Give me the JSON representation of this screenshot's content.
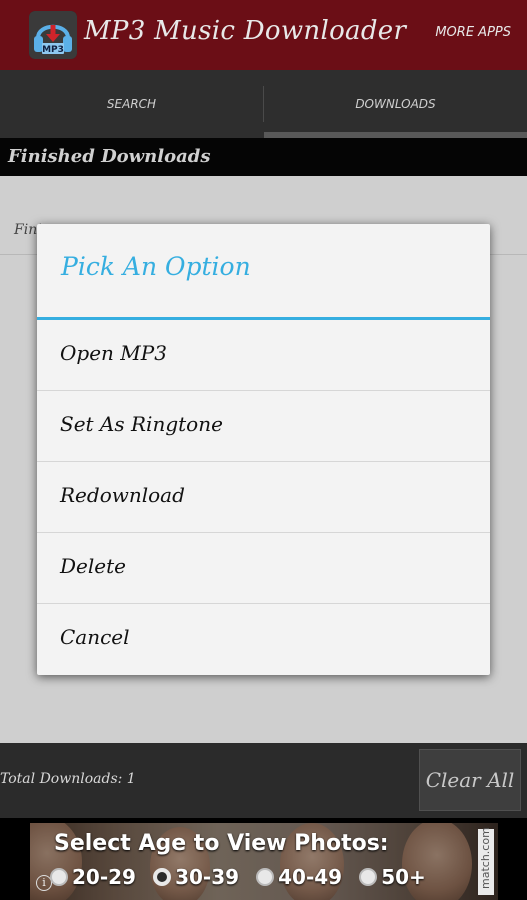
{
  "app": {
    "title": "MP3 Music Downloader",
    "icon": "mp3-headphones-icon",
    "icon_label": "MP3",
    "more_apps_label": "MORE APPS"
  },
  "tabs": [
    {
      "label": "SEARCH",
      "selected": false
    },
    {
      "label": "DOWNLOADS",
      "selected": true
    }
  ],
  "section": {
    "title": "Finished Downloads"
  },
  "list": {
    "items": [
      {
        "label_partial": "Fini"
      }
    ]
  },
  "footer": {
    "total_downloads_label": "Total Downloads: 1",
    "clear_all_label": "Clear All"
  },
  "ad": {
    "headline": "Select Age to View Photos:",
    "options": [
      {
        "label": "20-29",
        "selected": false
      },
      {
        "label": "30-39",
        "selected": true
      },
      {
        "label": "40-49",
        "selected": false
      },
      {
        "label": "50+",
        "selected": false
      }
    ],
    "brand": "match.com",
    "info_glyph": "i"
  },
  "dialog": {
    "title": "Pick An Option",
    "options": [
      {
        "label": "Open MP3"
      },
      {
        "label": "Set As Ringtone"
      },
      {
        "label": "Redownload"
      },
      {
        "label": "Delete"
      },
      {
        "label": "Cancel"
      }
    ]
  },
  "colors": {
    "action_bar": "#6b0e16",
    "accent": "#35aee0",
    "dialog_bg": "#f3f3f3"
  }
}
